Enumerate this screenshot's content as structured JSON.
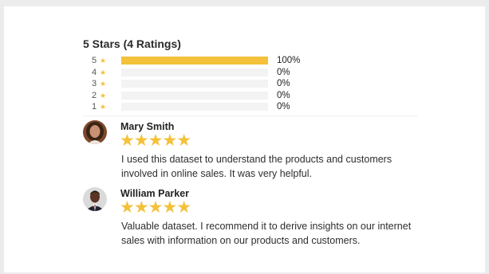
{
  "rating_summary": {
    "title": "5 Stars (4 Ratings)",
    "star_glyph": "★",
    "accent_color": "#f4c13b",
    "bars": [
      {
        "stars": "5",
        "percent_label": "100%",
        "fill_percent": 100
      },
      {
        "stars": "4",
        "percent_label": "0%",
        "fill_percent": 0
      },
      {
        "stars": "3",
        "percent_label": "0%",
        "fill_percent": 0
      },
      {
        "stars": "2",
        "percent_label": "0%",
        "fill_percent": 0
      },
      {
        "stars": "1",
        "percent_label": "0%",
        "fill_percent": 0
      }
    ]
  },
  "reviews": [
    {
      "name": "Mary Smith",
      "rating": 5,
      "stars": "★★★★★",
      "avatar_icon": "woman-portrait",
      "text": "I used this dataset to understand the products and customers involved in online sales. It was very helpful."
    },
    {
      "name": "William Parker",
      "rating": 5,
      "stars": "★★★★★",
      "avatar_icon": "man-portrait",
      "text": "Valuable dataset. I recommend it to derive insights on our internet sales with information on our products and customers."
    }
  ]
}
